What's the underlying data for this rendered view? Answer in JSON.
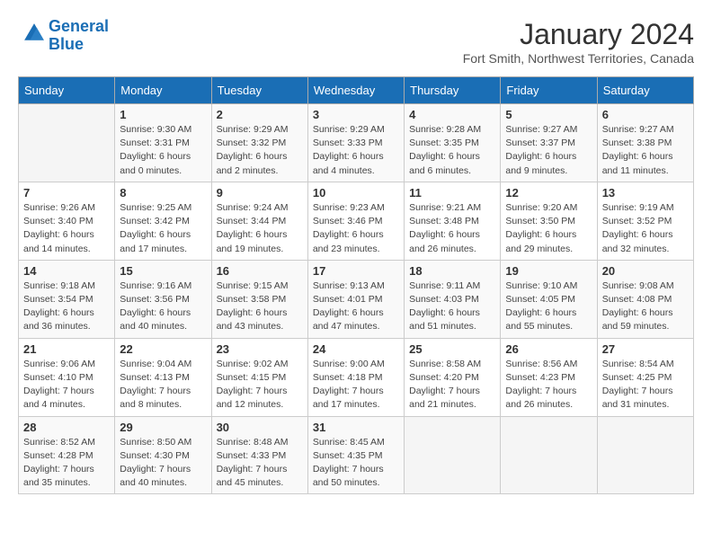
{
  "header": {
    "logo_line1": "General",
    "logo_line2": "Blue",
    "month": "January 2024",
    "location": "Fort Smith, Northwest Territories, Canada"
  },
  "days_of_week": [
    "Sunday",
    "Monday",
    "Tuesday",
    "Wednesday",
    "Thursday",
    "Friday",
    "Saturday"
  ],
  "weeks": [
    [
      {
        "day": "",
        "info": ""
      },
      {
        "day": "1",
        "info": "Sunrise: 9:30 AM\nSunset: 3:31 PM\nDaylight: 6 hours\nand 0 minutes."
      },
      {
        "day": "2",
        "info": "Sunrise: 9:29 AM\nSunset: 3:32 PM\nDaylight: 6 hours\nand 2 minutes."
      },
      {
        "day": "3",
        "info": "Sunrise: 9:29 AM\nSunset: 3:33 PM\nDaylight: 6 hours\nand 4 minutes."
      },
      {
        "day": "4",
        "info": "Sunrise: 9:28 AM\nSunset: 3:35 PM\nDaylight: 6 hours\nand 6 minutes."
      },
      {
        "day": "5",
        "info": "Sunrise: 9:27 AM\nSunset: 3:37 PM\nDaylight: 6 hours\nand 9 minutes."
      },
      {
        "day": "6",
        "info": "Sunrise: 9:27 AM\nSunset: 3:38 PM\nDaylight: 6 hours\nand 11 minutes."
      }
    ],
    [
      {
        "day": "7",
        "info": "Sunrise: 9:26 AM\nSunset: 3:40 PM\nDaylight: 6 hours\nand 14 minutes."
      },
      {
        "day": "8",
        "info": "Sunrise: 9:25 AM\nSunset: 3:42 PM\nDaylight: 6 hours\nand 17 minutes."
      },
      {
        "day": "9",
        "info": "Sunrise: 9:24 AM\nSunset: 3:44 PM\nDaylight: 6 hours\nand 19 minutes."
      },
      {
        "day": "10",
        "info": "Sunrise: 9:23 AM\nSunset: 3:46 PM\nDaylight: 6 hours\nand 23 minutes."
      },
      {
        "day": "11",
        "info": "Sunrise: 9:21 AM\nSunset: 3:48 PM\nDaylight: 6 hours\nand 26 minutes."
      },
      {
        "day": "12",
        "info": "Sunrise: 9:20 AM\nSunset: 3:50 PM\nDaylight: 6 hours\nand 29 minutes."
      },
      {
        "day": "13",
        "info": "Sunrise: 9:19 AM\nSunset: 3:52 PM\nDaylight: 6 hours\nand 32 minutes."
      }
    ],
    [
      {
        "day": "14",
        "info": "Sunrise: 9:18 AM\nSunset: 3:54 PM\nDaylight: 6 hours\nand 36 minutes."
      },
      {
        "day": "15",
        "info": "Sunrise: 9:16 AM\nSunset: 3:56 PM\nDaylight: 6 hours\nand 40 minutes."
      },
      {
        "day": "16",
        "info": "Sunrise: 9:15 AM\nSunset: 3:58 PM\nDaylight: 6 hours\nand 43 minutes."
      },
      {
        "day": "17",
        "info": "Sunrise: 9:13 AM\nSunset: 4:01 PM\nDaylight: 6 hours\nand 47 minutes."
      },
      {
        "day": "18",
        "info": "Sunrise: 9:11 AM\nSunset: 4:03 PM\nDaylight: 6 hours\nand 51 minutes."
      },
      {
        "day": "19",
        "info": "Sunrise: 9:10 AM\nSunset: 4:05 PM\nDaylight: 6 hours\nand 55 minutes."
      },
      {
        "day": "20",
        "info": "Sunrise: 9:08 AM\nSunset: 4:08 PM\nDaylight: 6 hours\nand 59 minutes."
      }
    ],
    [
      {
        "day": "21",
        "info": "Sunrise: 9:06 AM\nSunset: 4:10 PM\nDaylight: 7 hours\nand 4 minutes."
      },
      {
        "day": "22",
        "info": "Sunrise: 9:04 AM\nSunset: 4:13 PM\nDaylight: 7 hours\nand 8 minutes."
      },
      {
        "day": "23",
        "info": "Sunrise: 9:02 AM\nSunset: 4:15 PM\nDaylight: 7 hours\nand 12 minutes."
      },
      {
        "day": "24",
        "info": "Sunrise: 9:00 AM\nSunset: 4:18 PM\nDaylight: 7 hours\nand 17 minutes."
      },
      {
        "day": "25",
        "info": "Sunrise: 8:58 AM\nSunset: 4:20 PM\nDaylight: 7 hours\nand 21 minutes."
      },
      {
        "day": "26",
        "info": "Sunrise: 8:56 AM\nSunset: 4:23 PM\nDaylight: 7 hours\nand 26 minutes."
      },
      {
        "day": "27",
        "info": "Sunrise: 8:54 AM\nSunset: 4:25 PM\nDaylight: 7 hours\nand 31 minutes."
      }
    ],
    [
      {
        "day": "28",
        "info": "Sunrise: 8:52 AM\nSunset: 4:28 PM\nDaylight: 7 hours\nand 35 minutes."
      },
      {
        "day": "29",
        "info": "Sunrise: 8:50 AM\nSunset: 4:30 PM\nDaylight: 7 hours\nand 40 minutes."
      },
      {
        "day": "30",
        "info": "Sunrise: 8:48 AM\nSunset: 4:33 PM\nDaylight: 7 hours\nand 45 minutes."
      },
      {
        "day": "31",
        "info": "Sunrise: 8:45 AM\nSunset: 4:35 PM\nDaylight: 7 hours\nand 50 minutes."
      },
      {
        "day": "",
        "info": ""
      },
      {
        "day": "",
        "info": ""
      },
      {
        "day": "",
        "info": ""
      }
    ]
  ]
}
